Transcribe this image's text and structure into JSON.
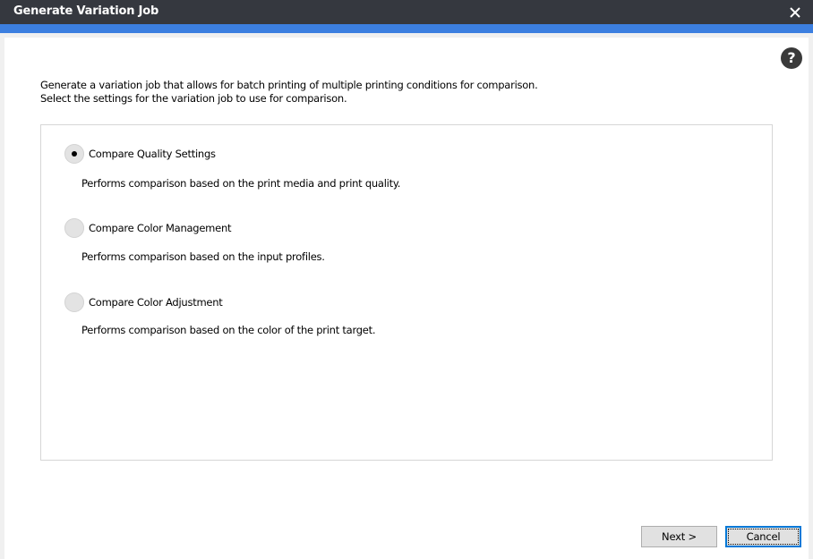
{
  "window": {
    "title": "Generate Variation Job",
    "close_icon": "close-icon",
    "colors": {
      "titlebar": "#35383f",
      "accent": "#3c7fe0"
    }
  },
  "help": {
    "label": "?",
    "icon": "help-icon"
  },
  "intro": {
    "line1": "Generate a variation job that allows for batch printing of multiple printing conditions for comparison.",
    "line2": "Select the settings for the variation job to use for comparison."
  },
  "options": [
    {
      "label": "Compare Quality Settings",
      "description": "Performs comparison based on the print media and print quality.",
      "selected": true
    },
    {
      "label": "Compare Color Management",
      "description": "Performs comparison based on the input profiles.",
      "selected": false
    },
    {
      "label": "Compare Color Adjustment",
      "description": "Performs comparison based on the color of the print target.",
      "selected": false
    }
  ],
  "buttons": {
    "next_label": "Next >",
    "cancel_label": "Cancel"
  }
}
